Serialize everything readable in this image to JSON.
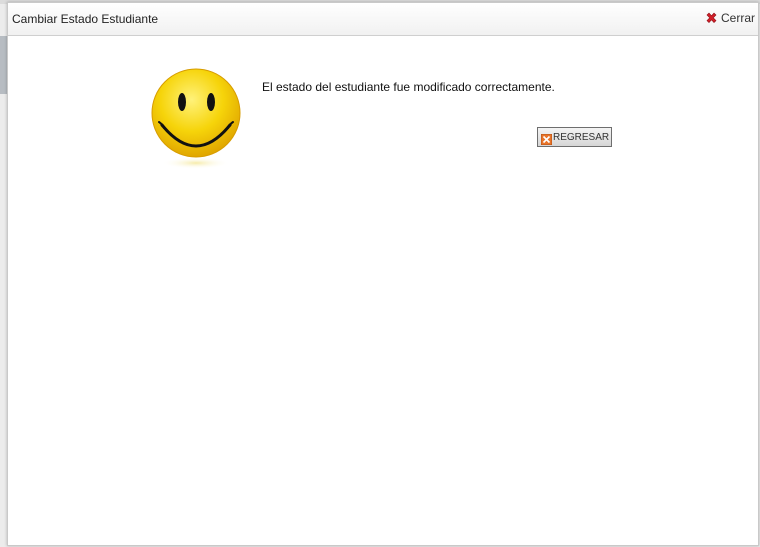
{
  "dialog": {
    "title": "Cambiar Estado Estudiante",
    "close_label": "Cerrar"
  },
  "content": {
    "message": "El estado del estudiante fue modificado correctamente.",
    "back_button_label": "REGRESAR",
    "image_icon": "smiley-face-icon"
  },
  "colors": {
    "smiley_yellow": "#f6d40a",
    "close_icon_red": "#d2202a",
    "back_icon_orange": "#e8742a"
  }
}
